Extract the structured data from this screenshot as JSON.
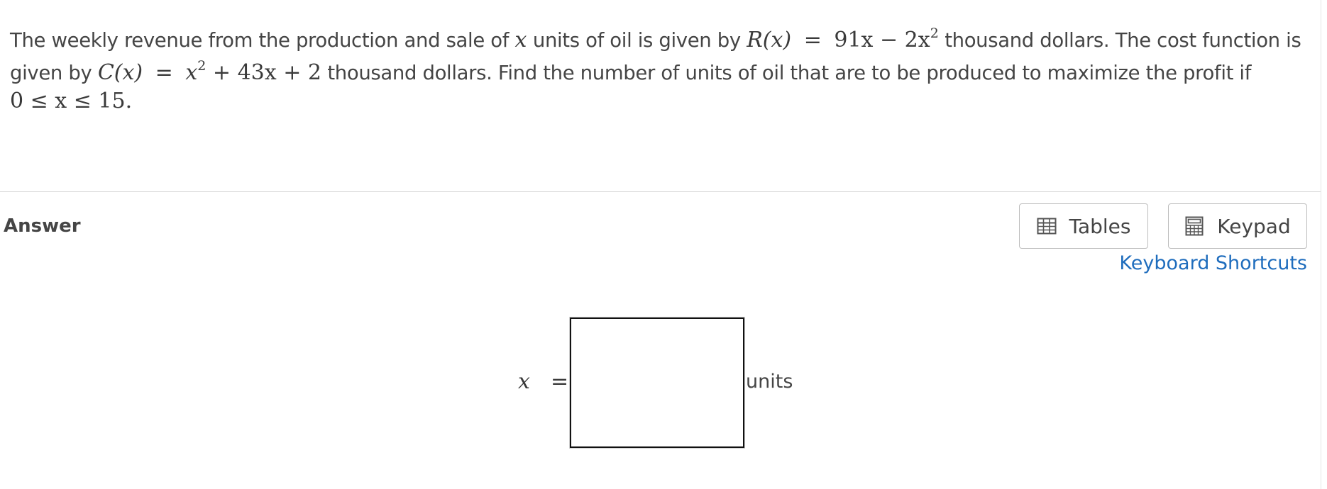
{
  "question": {
    "line1_text_a": "The weekly revenue from the production and sale of",
    "var_x": "x",
    "line1_text_b": "units of oil is given by",
    "revenue_lhs": "R(x)",
    "revenue_rhs": "91x − 2x",
    "exponent": "2",
    "line1_text_c": "thousand dollars. The cost function is",
    "line2_text_a": "given by",
    "cost_lhs": "C(x)",
    "cost_rhs_a": "x",
    "cost_rhs_b": "+ 43x + 2",
    "line2_text_b": "thousand dollars. Find the number of units of oil that are to be produced to maximize the profit if",
    "constraint": "0 ≤ x ≤ 15."
  },
  "answer": {
    "label": "Answer",
    "tables_label": "Tables",
    "keypad_label": "Keypad",
    "shortcuts_label": "Keyboard Shortcuts",
    "var_label": "x",
    "equals": "=",
    "input_value": "",
    "units_label": "units"
  },
  "icons": {
    "tables": "table-grid-icon",
    "keypad": "calculator-icon"
  },
  "colors": {
    "link": "#1f6dbd",
    "text": "#454545",
    "divider": "#d9d9d9"
  }
}
